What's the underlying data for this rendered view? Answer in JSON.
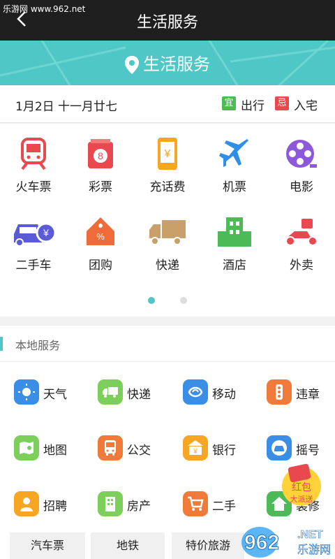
{
  "watermark": "乐游网 www.962.net",
  "header": {
    "title": "生活服务"
  },
  "banner": {
    "label": "生活服务"
  },
  "date_row": {
    "date": "1月2日 十一月廿七",
    "yi_badge": "宜",
    "yi_text": "出行",
    "ji_badge": "忌",
    "ji_text": "入宅"
  },
  "grid": {
    "items": [
      {
        "label": "火车票",
        "icon": "train-icon",
        "color": "#e8484e"
      },
      {
        "label": "彩票",
        "icon": "lottery-icon",
        "color": "#e8484e"
      },
      {
        "label": "充话费",
        "icon": "phone-recharge-icon",
        "color": "#f6a623"
      },
      {
        "label": "机票",
        "icon": "plane-icon",
        "color": "#2f8fe6"
      },
      {
        "label": "电影",
        "icon": "film-reel-icon",
        "color": "#8b59d9"
      },
      {
        "label": "二手车",
        "icon": "used-car-icon",
        "color": "#5b5bd6"
      },
      {
        "label": "团购",
        "icon": "discount-tag-icon",
        "color": "#f06a3a"
      },
      {
        "label": "快递",
        "icon": "truck-icon",
        "color": "#c9a06a"
      },
      {
        "label": "酒店",
        "icon": "hotel-icon",
        "color": "#4cba57"
      },
      {
        "label": "外卖",
        "icon": "scooter-icon",
        "color": "#e8484e"
      }
    ],
    "page_dots": 2,
    "active_dot": 1
  },
  "local": {
    "title": "本地服务",
    "items": [
      {
        "label": "天气",
        "icon": "sun-icon",
        "color": "#3a8ee6"
      },
      {
        "label": "快递",
        "icon": "truck-icon",
        "color": "#7ccf5a"
      },
      {
        "label": "移动",
        "icon": "china-mobile-icon",
        "color": "#3a8ee6"
      },
      {
        "label": "违章",
        "icon": "traffic-light-icon",
        "color": "#f07a3a"
      },
      {
        "label": "地图",
        "icon": "map-icon",
        "color": "#7ccf5a"
      },
      {
        "label": "公交",
        "icon": "bus-icon",
        "color": "#f07a3a"
      },
      {
        "label": "银行",
        "icon": "bank-icon",
        "color": "#f6a623"
      },
      {
        "label": "摇号",
        "icon": "car-icon",
        "color": "#3a8ee6"
      },
      {
        "label": "招聘",
        "icon": "person-icon",
        "color": "#f6a623"
      },
      {
        "label": "房产",
        "icon": "building-icon",
        "color": "#7ccf5a"
      },
      {
        "label": "二手",
        "icon": "cart-icon",
        "color": "#f07a3a"
      },
      {
        "label": "装修",
        "icon": "house-icon",
        "color": "#4cba57"
      }
    ]
  },
  "tags": [
    "汽车票",
    "地铁",
    "特价旅游"
  ],
  "promo": {
    "line1": "红包",
    "line2": "大派送"
  },
  "corner_logo": {
    "text": "962",
    "sub": "乐游网",
    "domain": ".NET"
  }
}
